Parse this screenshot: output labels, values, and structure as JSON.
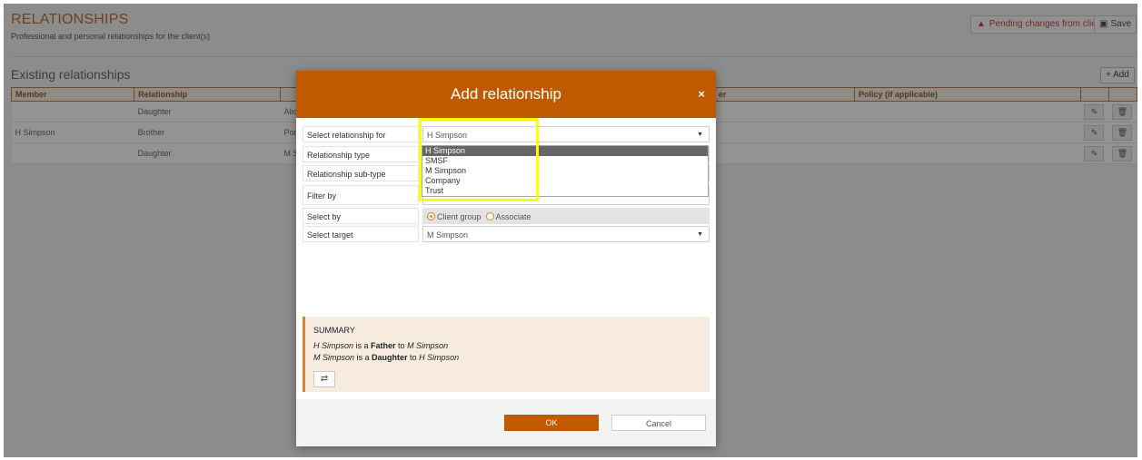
{
  "page": {
    "title": "RELATIONSHIPS",
    "subtitle": "Professional and personal relationships for the client(s)",
    "pending_label": "Pending changes from client",
    "save_label": "Save",
    "section_title": "Existing relationships",
    "add_label": "Add"
  },
  "table": {
    "headers": [
      "Member",
      "Relationship",
      "",
      "",
      "",
      "er",
      "Policy (if applicable)",
      "",
      ""
    ],
    "rows": [
      {
        "member": "",
        "relationship": "Daughter",
        "target": "Alic"
      },
      {
        "member": "H Simpson",
        "relationship": "Brother",
        "target": "Por"
      },
      {
        "member": "",
        "relationship": "Daughter",
        "target": "M S"
      }
    ]
  },
  "modal": {
    "title": "Add relationship",
    "close": "×",
    "fields": {
      "relationship_for": {
        "label": "Select relationship for",
        "value": "H Simpson"
      },
      "relationship_type": {
        "label": "Relationship type"
      },
      "relationship_subtype": {
        "label": "Relationship sub-type"
      },
      "filter_by": {
        "label": "Filter by"
      },
      "select_by": {
        "label": "Select by",
        "option_client": "Client group",
        "option_associate": "Associate"
      },
      "select_target": {
        "label": "Select target",
        "value": "M Simpson"
      }
    },
    "dropdown_options": [
      "H Simpson",
      "SMSF",
      "M Simpson",
      "Company",
      "Trust"
    ],
    "summary": {
      "title": "SUMMARY",
      "line1": {
        "a": "H Simpson",
        "mid1": " is a ",
        "rel": "Father",
        "mid2": " to ",
        "b": "M Simpson"
      },
      "line2": {
        "a": "M Simpson",
        "mid1": " is a ",
        "rel": "Daughter",
        "mid2": " to ",
        "b": "H Simpson"
      },
      "swap_icon": "⇄"
    },
    "ok_label": "OK",
    "cancel_label": "Cancel"
  },
  "colors": {
    "accent": "#bf5a00",
    "highlight": "#ffff00",
    "pending": "#c62828"
  }
}
